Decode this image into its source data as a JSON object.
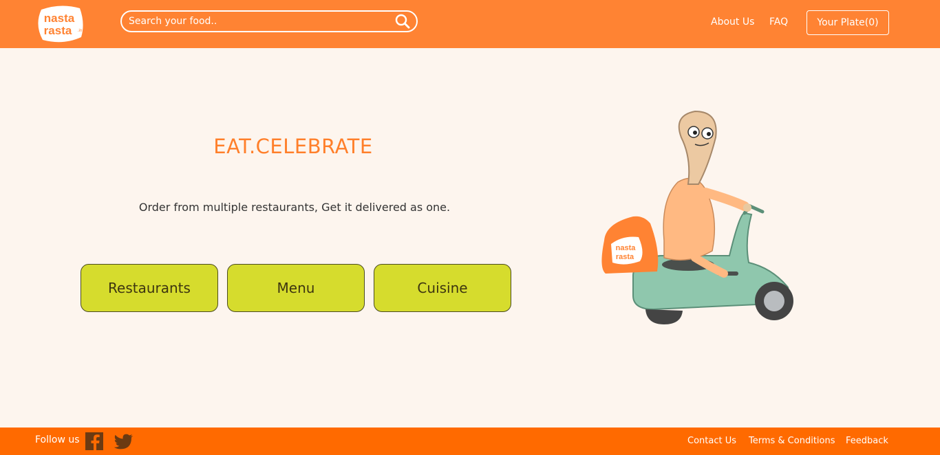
{
  "header": {
    "logo_text_top": "nasta",
    "logo_text_bottom": "rasta",
    "logo_suffix": ".in",
    "search_placeholder": "Search your food..",
    "nav": {
      "about": "About Us",
      "faq": "FAQ"
    },
    "plate_label": "Your Plate(0)"
  },
  "hero": {
    "headline": "EAT.CELEBRATE",
    "tagline": "Order from multiple restaurants, Get it delivered as one.",
    "buttons": [
      "Restaurants",
      "Menu",
      "Cuisine"
    ]
  },
  "footer": {
    "follow_label": "Follow us",
    "social_icons": [
      "facebook-icon",
      "twitter-icon"
    ],
    "links": [
      "Contact Us",
      "Terms & Conditions",
      "Feedback"
    ]
  },
  "colors": {
    "header_bg": "#ff8333",
    "footer_bg": "#ff6a00",
    "page_bg": "#fdf5ee",
    "accent": "#ff7f2a",
    "button_bg": "#d6dc2d"
  }
}
